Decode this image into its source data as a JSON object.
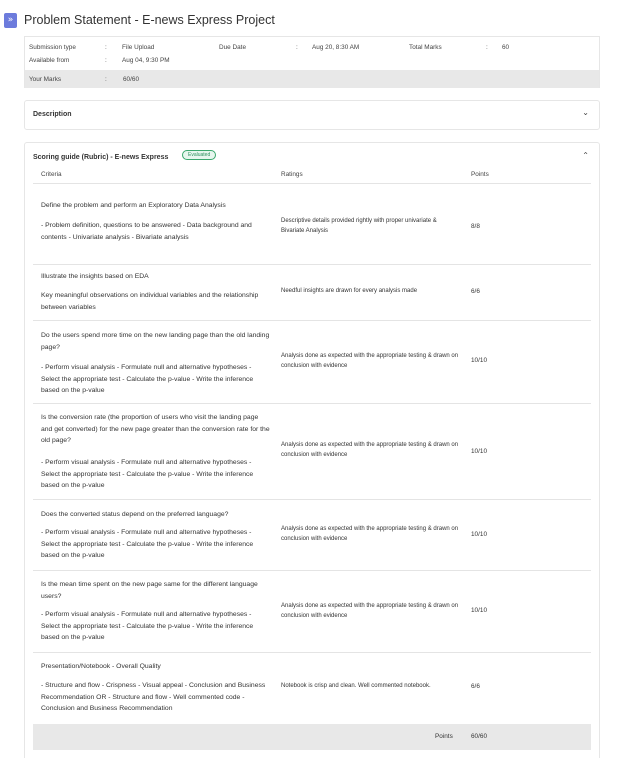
{
  "header": {
    "expand_glyph": "»",
    "title": "Problem Statement - E-news Express Project"
  },
  "info": {
    "submission_type_label": "Submission type",
    "submission_type_value": "File Upload",
    "due_date_label": "Due Date",
    "due_date_value": "Aug 20, 8:30 AM",
    "total_marks_label": "Total Marks",
    "total_marks_value": "60",
    "available_from_label": "Available from",
    "available_from_value": "Aug 04, 9:30 PM",
    "your_marks_label": "Your Marks",
    "your_marks_value": "60/60",
    "separator": ":"
  },
  "description": {
    "label": "Description",
    "chevron": "⌄"
  },
  "rubric": {
    "title": "Scoring guide (Rubric) - E-news Express",
    "badge": "Evaluated",
    "chevron": "⌃",
    "columns": {
      "criteria": "Criteria",
      "ratings": "Ratings",
      "points": "Points"
    },
    "rows": [
      {
        "title": "Define the problem and perform an Exploratory Data Analysis",
        "description": "- Problem definition, questions to be answered - Data background and contents - Univariate analysis - Bivariate analysis",
        "rating": "Descriptive details provided rightly with proper univariate & Bivariate Analysis",
        "points": "8/8"
      },
      {
        "title": "Illustrate the insights based on EDA",
        "description": "Key meaningful observations on individual variables and the relationship between variables",
        "rating": "Needful insights are drawn for every analysis made",
        "points": "6/6"
      },
      {
        "title": "Do the users spend more time on the new landing page than the old landing page?",
        "description": "- Perform visual analysis - Formulate null and alternative hypotheses - Select the appropriate test - Calculate the p-value - Write the inference based on the p-value",
        "rating": "Analysis done as expected with the appropriate testing & drawn on conclusion with evidence",
        "points": "10/10"
      },
      {
        "title": "Is the conversion rate (the proportion of users who visit the landing page and get converted) for the new page greater than the conversion rate for the old page?",
        "description": "- Perform visual analysis - Formulate null and alternative hypotheses - Select the appropriate test - Calculate the p-value - Write the inference based on the p-value",
        "rating": "Analysis done as expected with the appropriate testing & drawn on conclusion with evidence",
        "points": "10/10"
      },
      {
        "title": "Does the converted status depend on the preferred language?",
        "description": "- Perform visual analysis - Formulate null and alternative hypotheses - Select the appropriate test - Calculate the p-value - Write the inference based on the p-value",
        "rating": "Analysis done as expected with the appropriate testing & drawn on conclusion with evidence",
        "points": "10/10"
      },
      {
        "title": "Is the mean time spent on the new page same for the different language users?",
        "description": "- Perform visual analysis - Formulate null and alternative hypotheses - Select the appropriate test - Calculate the p-value - Write the inference based on the p-value",
        "rating": "Analysis done as expected with the appropriate testing & drawn on conclusion with evidence",
        "points": "10/10"
      },
      {
        "title": "Presentation/Notebook - Overall Quality",
        "description": "- Structure and flow - Crispness - Visual appeal - Conclusion and Business Recommendation OR - Structure and flow - Well commented code - Conclusion and Business Recommendation",
        "rating": "Notebook is crisp and clean. Well commented notebook.",
        "points": "6/6"
      }
    ],
    "total_label": "Points",
    "total_value": "60/60"
  }
}
